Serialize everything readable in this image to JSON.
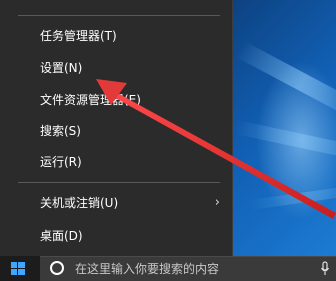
{
  "menu": {
    "cut_item": "—",
    "items": [
      {
        "label": "任务管理器(T)"
      },
      {
        "label": "设置(N)"
      },
      {
        "label": "文件资源管理器(E)"
      },
      {
        "label": "搜索(S)"
      },
      {
        "label": "运行(R)"
      },
      {
        "label": "关机或注销(U)",
        "submenu": "›"
      },
      {
        "label": "桌面(D)"
      }
    ]
  },
  "taskbar": {
    "search_placeholder": "在这里输入你要搜索的内容"
  },
  "colors": {
    "menu_bg": "#2b2b2b",
    "arrow": "#e23a3a",
    "taskbar_bg": "#1c1c1c",
    "start_logo": "#3fa7ff"
  },
  "icons": {
    "start": "windows-logo-icon",
    "cortana": "cortana-ring-icon",
    "mic": "microphone-icon",
    "submenu": "chevron-right-icon"
  }
}
